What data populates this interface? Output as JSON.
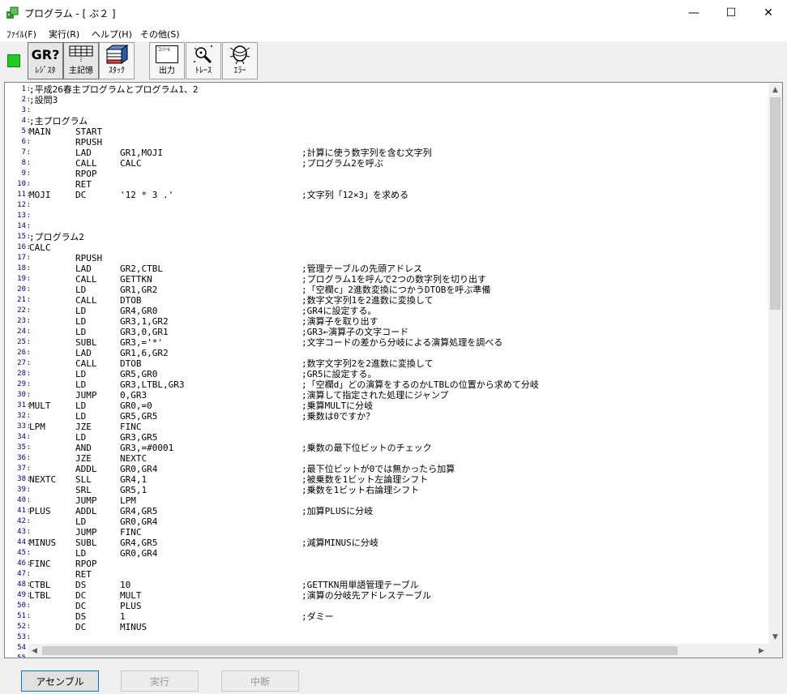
{
  "window": {
    "title": "プログラム - [ ぶ２ ]",
    "minimize": "—",
    "maximize": "☐",
    "close": "✕"
  },
  "menu": {
    "items": [
      "ﾌｧｲﾙ(F)",
      "実行(R)",
      "ヘルプ(H)",
      "その他(S)"
    ]
  },
  "toolbar": {
    "status_led_color": "#22cc22",
    "buttons": [
      {
        "label": "ﾚｼﾞｽﾀ",
        "icon": "GR?",
        "icon_name": "register-icon",
        "pressed": true
      },
      {
        "label": "主記憶",
        "icon": "",
        "icon_name": "memory-grid-icon",
        "pressed": true
      },
      {
        "label": "ｽﾀｯｸ",
        "icon": "",
        "icon_name": "stack-icon",
        "pressed": false
      },
      {
        "label": "出力",
        "icon": "ｺﾝｿｰﾙ",
        "icon_name": "console-output-icon",
        "pressed": false
      },
      {
        "label": "ﾄﾚｰｽ",
        "icon": "",
        "icon_name": "trace-magnifier-icon",
        "pressed": false
      },
      {
        "label": "ｴﾗｰ",
        "icon": "",
        "icon_name": "error-bug-icon",
        "pressed": false
      }
    ]
  },
  "editor": {
    "lines": [
      {
        "n": "1",
        "label": ";平成26春主プログラムとプログラム1、2",
        "op": "",
        "operand": "",
        "comment": ""
      },
      {
        "n": "2",
        "label": ";設問3",
        "op": "",
        "operand": "",
        "comment": ""
      },
      {
        "n": "3",
        "label": "",
        "op": "",
        "operand": "",
        "comment": ""
      },
      {
        "n": "4",
        "label": ";主プログラム",
        "op": "",
        "operand": "",
        "comment": ""
      },
      {
        "n": "5",
        "label": "MAIN",
        "op": "START",
        "operand": "",
        "comment": ""
      },
      {
        "n": "6",
        "label": "",
        "op": "RPUSH",
        "operand": "",
        "comment": ""
      },
      {
        "n": "7",
        "label": "",
        "op": "LAD",
        "operand": "GR1,MOJI",
        "comment": ";計算に使う数字列を含む文字列"
      },
      {
        "n": "8",
        "label": "",
        "op": "CALL",
        "operand": "CALC",
        "comment": ";プログラム2を呼ぶ"
      },
      {
        "n": "9",
        "label": "",
        "op": "RPOP",
        "operand": "",
        "comment": ""
      },
      {
        "n": "10",
        "label": "",
        "op": "RET",
        "operand": "",
        "comment": ""
      },
      {
        "n": "11",
        "label": "MOJI",
        "op": "DC",
        "operand": "'12 * 3 .'",
        "comment": ";文字列「12×3」を求める"
      },
      {
        "n": "12",
        "label": "",
        "op": "",
        "operand": "",
        "comment": ""
      },
      {
        "n": "13",
        "label": "",
        "op": "",
        "operand": "",
        "comment": ""
      },
      {
        "n": "14",
        "label": "",
        "op": "",
        "operand": "",
        "comment": ""
      },
      {
        "n": "15",
        "label": ";プログラム2",
        "op": "",
        "operand": "",
        "comment": ""
      },
      {
        "n": "16",
        "label": "CALC",
        "op": "",
        "operand": "",
        "comment": ""
      },
      {
        "n": "17",
        "label": "",
        "op": "RPUSH",
        "operand": "",
        "comment": ""
      },
      {
        "n": "18",
        "label": "",
        "op": "LAD",
        "operand": "GR2,CTBL",
        "comment": ";管理テーブルの先頭アドレス"
      },
      {
        "n": "19",
        "label": "",
        "op": "CALL",
        "operand": "GETTKN",
        "comment": ";プログラム1を呼んで2つの数字列を切り出す"
      },
      {
        "n": "20",
        "label": "",
        "op": "LD",
        "operand": "GR1,GR2",
        "comment": ";「空欄c」2進数変換につかうDTOBを呼ぶ準備"
      },
      {
        "n": "21",
        "label": "",
        "op": "CALL",
        "operand": "DTOB",
        "comment": ";数字文字列1を2進数に変換して"
      },
      {
        "n": "22",
        "label": "",
        "op": "LD",
        "operand": "GR4,GR0",
        "comment": ";GR4に設定する。"
      },
      {
        "n": "23",
        "label": "",
        "op": "LD",
        "operand": "GR3,1,GR2",
        "comment": ";演算子を取り出す"
      },
      {
        "n": "24",
        "label": "",
        "op": "LD",
        "operand": "GR3,0,GR1",
        "comment": ";GR3←演算子の文字コード"
      },
      {
        "n": "25",
        "label": "",
        "op": "SUBL",
        "operand": "GR3,='*'",
        "comment": ";文字コードの差から分岐による演算処理を調べる"
      },
      {
        "n": "26",
        "label": "",
        "op": "LAD",
        "operand": "GR1,6,GR2",
        "comment": ""
      },
      {
        "n": "27",
        "label": "",
        "op": "CALL",
        "operand": "DTOB",
        "comment": ";数字文字列2を2進数に変換して"
      },
      {
        "n": "28",
        "label": "",
        "op": "LD",
        "operand": "GR5,GR0",
        "comment": ";GR5に設定する。"
      },
      {
        "n": "29",
        "label": "",
        "op": "LD",
        "operand": "GR3,LTBL,GR3",
        "comment": ";「空欄d」どの演算をするのかLTBLの位置から求めて分岐"
      },
      {
        "n": "30",
        "label": "",
        "op": "JUMP",
        "operand": "0,GR3",
        "comment": ";演算して指定された処理にジャンプ"
      },
      {
        "n": "31",
        "label": "MULT",
        "op": "LD",
        "operand": "GR0,=0",
        "comment": ";乗算MULTに分岐"
      },
      {
        "n": "32",
        "label": "",
        "op": "LD",
        "operand": "GR5,GR5",
        "comment": ";乗数は0ですか？"
      },
      {
        "n": "33",
        "label": "LPM",
        "op": "JZE",
        "operand": "FINC",
        "comment": ""
      },
      {
        "n": "34",
        "label": "",
        "op": "LD",
        "operand": "GR3,GR5",
        "comment": ""
      },
      {
        "n": "35",
        "label": "",
        "op": "AND",
        "operand": "GR3,=#0001",
        "comment": ";乗数の最下位ビットのチェック"
      },
      {
        "n": "36",
        "label": "",
        "op": "JZE",
        "operand": "NEXTC",
        "comment": ""
      },
      {
        "n": "37",
        "label": "",
        "op": "ADDL",
        "operand": "GR0,GR4",
        "comment": ";最下位ビットが0では無かったら加算"
      },
      {
        "n": "38",
        "label": "NEXTC",
        "op": "SLL",
        "operand": "GR4,1",
        "comment": ";被乗数を1ビット左論理シフト"
      },
      {
        "n": "39",
        "label": "",
        "op": "SRL",
        "operand": "GR5,1",
        "comment": ";乗数を1ビット右論理シフト"
      },
      {
        "n": "40",
        "label": "",
        "op": "JUMP",
        "operand": "LPM",
        "comment": ""
      },
      {
        "n": "41",
        "label": "PLUS",
        "op": "ADDL",
        "operand": "GR4,GR5",
        "comment": ";加算PLUSに分岐"
      },
      {
        "n": "42",
        "label": "",
        "op": "LD",
        "operand": "GR0,GR4",
        "comment": ""
      },
      {
        "n": "43",
        "label": "",
        "op": "JUMP",
        "operand": "FINC",
        "comment": ""
      },
      {
        "n": "44",
        "label": "MINUS",
        "op": "SUBL",
        "operand": "GR4,GR5",
        "comment": ";減算MINUSに分岐"
      },
      {
        "n": "45",
        "label": "",
        "op": "LD",
        "operand": "GR0,GR4",
        "comment": ""
      },
      {
        "n": "46",
        "label": "FINC",
        "op": "RPOP",
        "operand": "",
        "comment": ""
      },
      {
        "n": "47",
        "label": "",
        "op": "RET",
        "operand": "",
        "comment": ""
      },
      {
        "n": "48",
        "label": "CTBL",
        "op": "DS",
        "operand": "10",
        "comment": ";GETTKN用単語管理テーブル"
      },
      {
        "n": "49",
        "label": "LTBL",
        "op": "DC",
        "operand": "MULT",
        "comment": ";演算の分岐先アドレステーブル"
      },
      {
        "n": "50",
        "label": "",
        "op": "DC",
        "operand": "PLUS",
        "comment": ""
      },
      {
        "n": "51",
        "label": "",
        "op": "DS",
        "operand": "1",
        "comment": ";ダミー"
      },
      {
        "n": "52",
        "label": "",
        "op": "DC",
        "operand": "MINUS",
        "comment": ""
      },
      {
        "n": "53",
        "label": "",
        "op": "",
        "operand": "",
        "comment": ""
      },
      {
        "n": "54",
        "label": "",
        "op": "",
        "operand": "",
        "comment": ""
      },
      {
        "n": "55",
        "label": "",
        "op": "",
        "operand": "",
        "comment": ""
      }
    ]
  },
  "bottom_buttons": [
    {
      "label": "アセンブル",
      "enabled": true
    },
    {
      "label": "実行",
      "enabled": false
    },
    {
      "label": "中断",
      "enabled": false
    }
  ]
}
